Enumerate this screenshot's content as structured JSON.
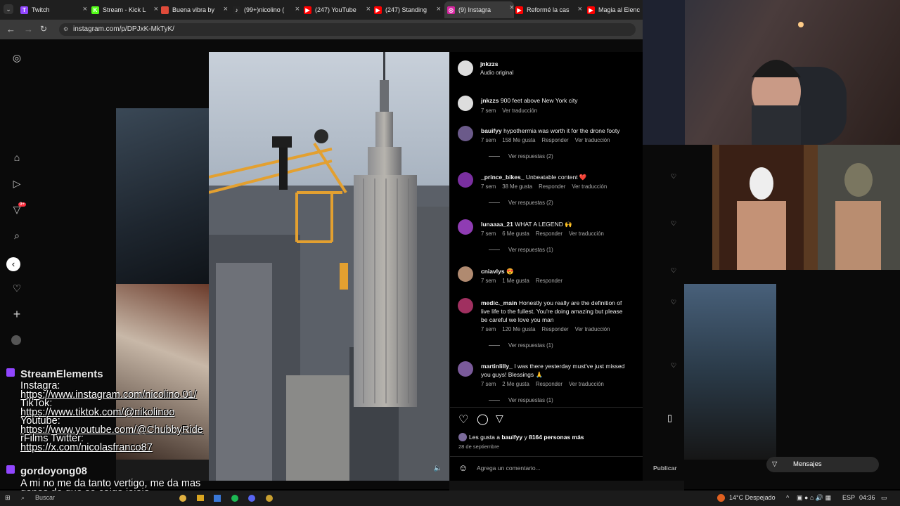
{
  "tabs": [
    {
      "label": "Twitch",
      "color": "#9146ff",
      "letter": "T"
    },
    {
      "label": "Stream - Kick L",
      "color": "#53fc18",
      "letter": "K"
    },
    {
      "label": "Buena vibra by",
      "color": "#e04b3a",
      "letter": ""
    },
    {
      "label": "(99+)nicolino (",
      "color": "#222222",
      "letter": "♪"
    },
    {
      "label": "(247) YouTube",
      "color": "#ff0000",
      "letter": "▶"
    },
    {
      "label": "(247) Standing",
      "color": "#ff0000",
      "letter": "▶"
    },
    {
      "label": "(9) Instagra",
      "color": "#d6249f",
      "letter": "◎"
    },
    {
      "label": "Reformé la cas",
      "color": "#ff0000",
      "letter": "▶"
    },
    {
      "label": "Magia al Elenc",
      "color": "#ff0000",
      "letter": "▶"
    }
  ],
  "address": {
    "url": "instagram.com/p/DPJxK-MkTyK/"
  },
  "post": {
    "author": "jnkzzs",
    "audio": "Audio original",
    "caption_user": "jnkzzs",
    "caption_text": "900 feet above New York city",
    "caption_age": "7 sem",
    "caption_translate": "Ver traducción",
    "likes_prefix": "Les gusta a",
    "likes_user": "bauifyy",
    "likes_and": "y",
    "likes_others": "8164 personas más",
    "date": "28 de septiembre",
    "comment_placeholder": "Agrega un comentario...",
    "publish": "Publicar"
  },
  "comments": [
    {
      "user": "bauifyy",
      "text": "hypothermia was worth it for the drone footy",
      "age": "7 sem",
      "likes": "158 Me gusta",
      "reply": "Responder",
      "translate": "Ver traducción",
      "replies": "Ver respuestas (2)",
      "avatar": "#6b5a8a"
    },
    {
      "user": "_prince_bikes_",
      "text": "Unbeatable content ❤️",
      "age": "7 sem",
      "likes": "38 Me gusta",
      "reply": "Responder",
      "translate": "Ver traducción",
      "replies": "Ver respuestas (2)",
      "avatar": "#7a2fa0"
    },
    {
      "user": "lunaaaa_21",
      "text": "WHAT A LEGEND 🙌",
      "age": "7 sem",
      "likes": "6 Me gusta",
      "reply": "Responder",
      "translate": "Ver traducción",
      "replies": "Ver respuestas (1)",
      "avatar": "#8f3cb3"
    },
    {
      "user": "cniavlys",
      "text": "😍",
      "age": "7 sem",
      "likes": "1 Me gusta",
      "reply": "Responder",
      "translate": "",
      "replies": "",
      "avatar": "#b08a70"
    },
    {
      "user": "medic._main",
      "text": "Honestly you really are the definition of live life to the fullest. You're doing amazing but please be careful we love you man",
      "age": "7 sem",
      "likes": "120 Me gusta",
      "reply": "Responder",
      "translate": "Ver traducción",
      "replies": "Ver respuestas (1)",
      "avatar": "#a03060"
    },
    {
      "user": "martinlilly_",
      "text": "I was there yesterday must've just missed you guys! Blessings 🙏",
      "age": "7 sem",
      "likes": "2 Me gusta",
      "reply": "Responder",
      "translate": "Ver traducción",
      "replies": "Ver respuestas (1)",
      "avatar": "#7a5a9a"
    }
  ],
  "overlay": {
    "streamelements_name": "StreamElements",
    "lines": [
      {
        "text": "Instagra:",
        "link": false
      },
      {
        "text": "https://www.instagram.com/nicolino.01/",
        "link": true
      },
      {
        "text": "TikTok:",
        "link": false
      },
      {
        "text": "https://www.tiktok.com/@nikolinoo",
        "link": true
      },
      {
        "text": "Youtube:",
        "link": false
      },
      {
        "text": "https://www.youtube.com/@ChubbyRide",
        "link": true
      },
      {
        "text": "rFilms Twitter:",
        "link": false
      },
      {
        "text": "https://x.com/nicolasfranco87",
        "link": true
      }
    ],
    "user2": "gordoyong08",
    "msg2_line1": "A mi no me da tanto vertigo, me da mas",
    "msg2_line2": "ganas de que se caiga jajaja",
    "messages_label": "Mensajes",
    "notif_badge": "9+"
  },
  "taskbar": {
    "search": "Buscar",
    "weather": "14°C Despejado",
    "lang": "ESP",
    "time": "04:36"
  }
}
